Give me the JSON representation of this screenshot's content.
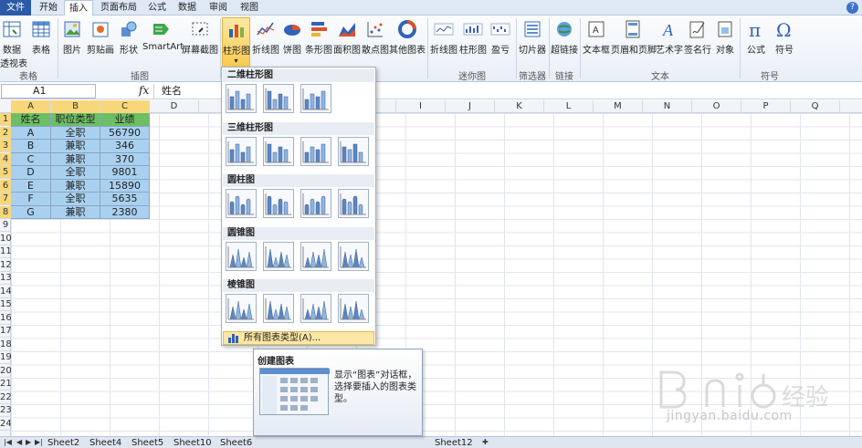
{
  "ribbon_tabs": [
    "文件",
    "开始",
    "插入",
    "页面布局",
    "公式",
    "数据",
    "审阅",
    "视图"
  ],
  "help_glyph": "?",
  "ribbon": {
    "buttons": [
      {
        "label": "数据",
        "label2": "透视表",
        "icon": "pivot-table-icon"
      },
      {
        "label": "表格",
        "icon": "table-icon"
      },
      {
        "label": "图片",
        "icon": "picture-icon"
      },
      {
        "label": "剪贴画",
        "icon": "clipart-icon"
      },
      {
        "label": "形状",
        "icon": "shapes-icon"
      },
      {
        "label": "SmartArt",
        "icon": "smartart-icon"
      },
      {
        "label": "屏幕截图",
        "icon": "screenshot-icon"
      },
      {
        "label": "柱形图",
        "icon": "column-chart-icon"
      },
      {
        "label": "折线图",
        "icon": "line-chart-icon"
      },
      {
        "label": "饼图",
        "icon": "pie-chart-icon"
      },
      {
        "label": "条形图",
        "icon": "bar-chart-icon"
      },
      {
        "label": "面积图",
        "icon": "area-chart-icon"
      },
      {
        "label": "散点图",
        "icon": "scatter-chart-icon"
      },
      {
        "label": "其他图表",
        "icon": "other-chart-icon"
      },
      {
        "label": "折线图",
        "icon": "sparkline-line-icon"
      },
      {
        "label": "柱形图",
        "icon": "sparkline-column-icon"
      },
      {
        "label": "盈亏",
        "icon": "sparkline-winloss-icon"
      },
      {
        "label": "切片器",
        "icon": "slicer-icon"
      },
      {
        "label": "超链接",
        "icon": "hyperlink-icon"
      },
      {
        "label": "文本框",
        "icon": "textbox-icon"
      },
      {
        "label": "页眉和页脚",
        "icon": "header-footer-icon"
      },
      {
        "label": "艺术字",
        "icon": "wordart-icon"
      },
      {
        "label": "签名行",
        "icon": "signature-icon"
      },
      {
        "label": "对象",
        "icon": "object-icon"
      },
      {
        "label": "公式",
        "icon": "equation-icon"
      },
      {
        "label": "符号",
        "icon": "symbol-icon"
      }
    ],
    "groups": [
      "表格",
      "插图",
      "迷你图",
      "筛选器",
      "链接",
      "文本",
      "符号"
    ]
  },
  "formula_bar": {
    "name_box": "A1",
    "fx": "fx",
    "value": "姓名"
  },
  "columns": [
    "A",
    "B",
    "C",
    "D",
    "E",
    "F",
    "G",
    "H",
    "I",
    "J",
    "K",
    "L",
    "M",
    "N",
    "O",
    "P",
    "Q"
  ],
  "rows": [
    "1",
    "2",
    "3",
    "4",
    "5",
    "6",
    "7",
    "8",
    "9",
    "10",
    "11",
    "12",
    "13",
    "14",
    "15",
    "16",
    "17",
    "18",
    "19",
    "20",
    "21",
    "22",
    "23",
    "24"
  ],
  "table": {
    "headers": [
      "姓名",
      "职位类型",
      "业绩"
    ],
    "rows": [
      [
        "A",
        "全职",
        "56790"
      ],
      [
        "B",
        "兼职",
        "346"
      ],
      [
        "C",
        "兼职",
        "370"
      ],
      [
        "D",
        "全职",
        "9801"
      ],
      [
        "E",
        "兼职",
        "15890"
      ],
      [
        "F",
        "全职",
        "5635"
      ],
      [
        "G",
        "兼职",
        "2380"
      ]
    ]
  },
  "dropdown": {
    "sections": [
      "二维柱形图",
      "三维柱形图",
      "圆柱图",
      "圆锥图",
      "棱锥图"
    ],
    "all_chart_types": "所有图表类型(A)..."
  },
  "tooltip": {
    "title": "创建图表",
    "description": "显示“图表”对话框，选择要插入的图表类型。"
  },
  "sheet_tabs": [
    "Sheet2",
    "Sheet4",
    "Sheet5",
    "Sheet10",
    "Sheet6",
    "Sheet12"
  ],
  "watermark": {
    "text": "jingyan.baidu.com",
    "brand": "Baidu经验"
  },
  "colors": {
    "header_fill": "#6cbf64",
    "data_fill": "#a9d1ef",
    "selected": "#f8c94d",
    "file_tab": "#2a5aa8"
  }
}
